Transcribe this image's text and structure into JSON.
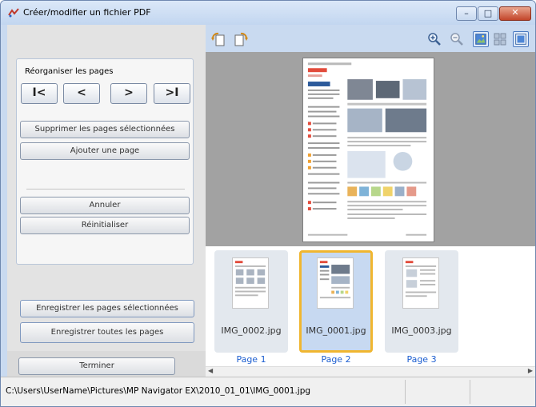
{
  "window": {
    "title": "Créer/modifier un fichier PDF"
  },
  "left": {
    "group_title": "Réorganiser les pages",
    "nav": [
      {
        "name": "first-page-button",
        "glyph": "I<"
      },
      {
        "name": "prev-page-button",
        "glyph": "<"
      },
      {
        "name": "next-page-button",
        "glyph": ">"
      },
      {
        "name": "last-page-button",
        "glyph": ">I"
      }
    ],
    "delete_selected": "Supprimer les pages sélectionnées",
    "add_page": "Ajouter une page",
    "cancel": "Annuler",
    "reset": "Réinitialiser",
    "save_selected": "Enregistrer les pages sélectionnées",
    "save_all": "Enregistrer toutes les pages",
    "finish": "Terminer"
  },
  "toolbar": {
    "icons": [
      "rotate-left-icon",
      "rotate-right-icon",
      "zoom-in-icon",
      "zoom-out-icon",
      "single-page-view-icon",
      "thumbnail-view-icon",
      "fit-page-icon"
    ]
  },
  "thumbnails": [
    {
      "file": "IMG_0002.jpg",
      "page": "Page 1",
      "selected": false
    },
    {
      "file": "IMG_0001.jpg",
      "page": "Page 2",
      "selected": true
    },
    {
      "file": "IMG_0003.jpg",
      "page": "Page 3",
      "selected": false
    }
  ],
  "status": {
    "path": "C:\\Users\\UserName\\Pictures\\MP Navigator EX\\2010_01_01\\IMG_0001.jpg"
  },
  "colors": {
    "accent": "#f0b630",
    "link": "#1d5fd1",
    "preview_bg": "#a2a2a2"
  }
}
